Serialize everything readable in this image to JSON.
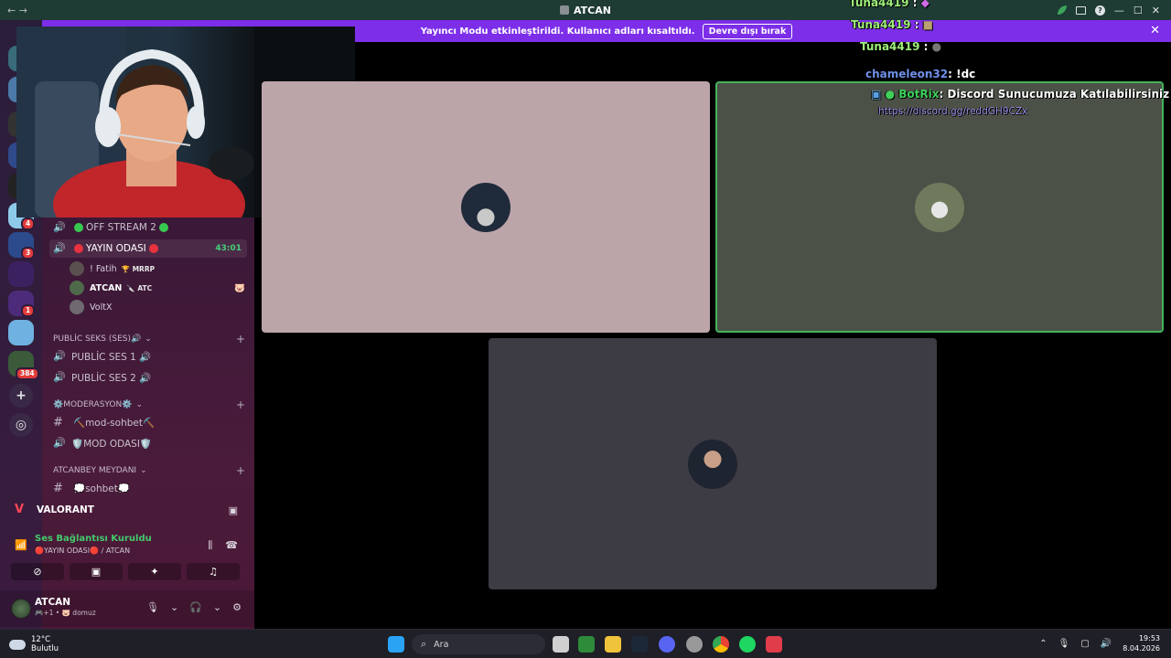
{
  "window": {
    "title": "ATCAN",
    "nav_back": "←",
    "nav_forward": "→",
    "controls": {
      "minimize": "—",
      "maximize": "☐",
      "close": "✕"
    }
  },
  "notice": {
    "text": "Yayıncı Modu etkinleştirildi. Kullanıcı adları kısaltıldı.",
    "button": "Devre dışı bırak",
    "close": "✕"
  },
  "rail": {
    "badges": [
      "4",
      "3",
      "1",
      "384"
    ],
    "add_icon": "+",
    "discover_icon": "◎"
  },
  "channels": {
    "voice_channels_top": [
      {
        "name": "OFF STREAM 2",
        "dots": "green"
      },
      {
        "name": "YAYIN ODASI",
        "dots": "red",
        "timer": "43:01"
      }
    ],
    "members": [
      {
        "name": "! Fatih",
        "tag": "🏆 MRRP"
      },
      {
        "name": "ATCAN",
        "tag": "🔪 ATC",
        "extra": "🐷"
      },
      {
        "name": "VoltX",
        "tag": ""
      }
    ],
    "categories": [
      {
        "label": "PUBLİC SEKS (SES)🔊",
        "items": [
          {
            "type": "voice",
            "name": "PUBLİC SES 1 🔊"
          },
          {
            "type": "voice",
            "name": "PUBLİC SES 2 🔊"
          }
        ]
      },
      {
        "label": "⚙️MODERASYON⚙️",
        "items": [
          {
            "type": "text",
            "name": "⛏️mod-sohbet⛏️"
          },
          {
            "type": "voice",
            "name": "🛡️MOD ODASI🛡️"
          }
        ]
      },
      {
        "label": "ATCANBEY MEYDANI",
        "items": [
          {
            "type": "text",
            "name": "💭sohbet💭"
          }
        ]
      }
    ]
  },
  "activity": {
    "game": "VALORANT"
  },
  "voice_panel": {
    "status": "Ses Bağlantısı Kuruldu",
    "sub": "🔴YAYIN ODASI🔴 / ATCAN",
    "buttons": [
      "camera-off",
      "screen-share",
      "activities",
      "soundboard"
    ]
  },
  "user_panel": {
    "name": "ATCAN",
    "status": "🎮+1 • 🐷 domuz"
  },
  "chat_overlay": [
    {
      "user": "Tuna4419",
      "msg": ":"
    },
    {
      "user": "Tuna4419",
      "msg": ":"
    },
    {
      "user": "Tuna4419",
      "msg": ":"
    },
    {
      "user": "chameleon32",
      "msg": ": !dc"
    },
    {
      "user": "BotRix",
      "msg": ": Discord Sunucumuza Katılabilirsiniz ..."
    },
    {
      "link": "https://discord.gg/reddGH9CZx"
    }
  ],
  "taskbar": {
    "weather_temp": "12°C",
    "weather_desc": "Bulutlu",
    "search_placeholder": "Ara",
    "time": "19:53",
    "date": "8.04.2026"
  },
  "colors": {
    "accent_purple": "#7c2ee8",
    "speaking_green": "#43b45c",
    "titlebar": "#1e3b34"
  }
}
